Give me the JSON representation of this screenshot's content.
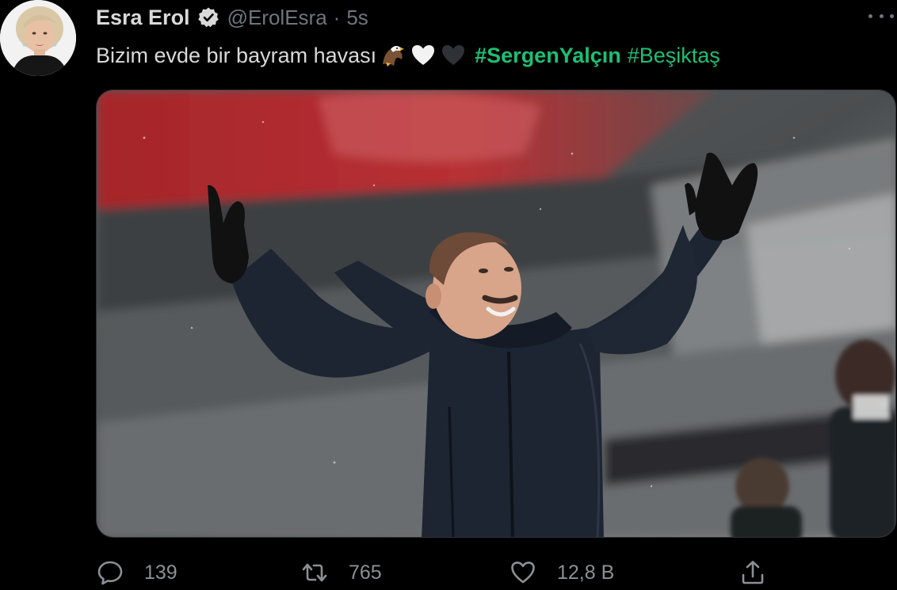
{
  "tweet": {
    "author": {
      "display_name": "Esra Erol",
      "handle": "@ErolEsra",
      "verified": true
    },
    "separator": "·",
    "time": "5s",
    "text": "Bizim evde bir bayram havası",
    "emojis": [
      "eagle-emoji",
      "white-heart-emoji",
      "black-heart-emoji"
    ],
    "hashtags": [
      "#SergenYalçın",
      "#Beşiktaş"
    ],
    "media": {
      "type": "photo",
      "subject": "coach-celebrating-arms-raised"
    }
  },
  "actions": {
    "reply_count": "139",
    "retweet_count": "765",
    "like_count": "12,8 B",
    "share_label": ""
  },
  "colors": {
    "background": "#000000",
    "primary_text": "#d9d9d9",
    "secondary_text": "#6e767d",
    "hashtag": "#1dbf73"
  }
}
